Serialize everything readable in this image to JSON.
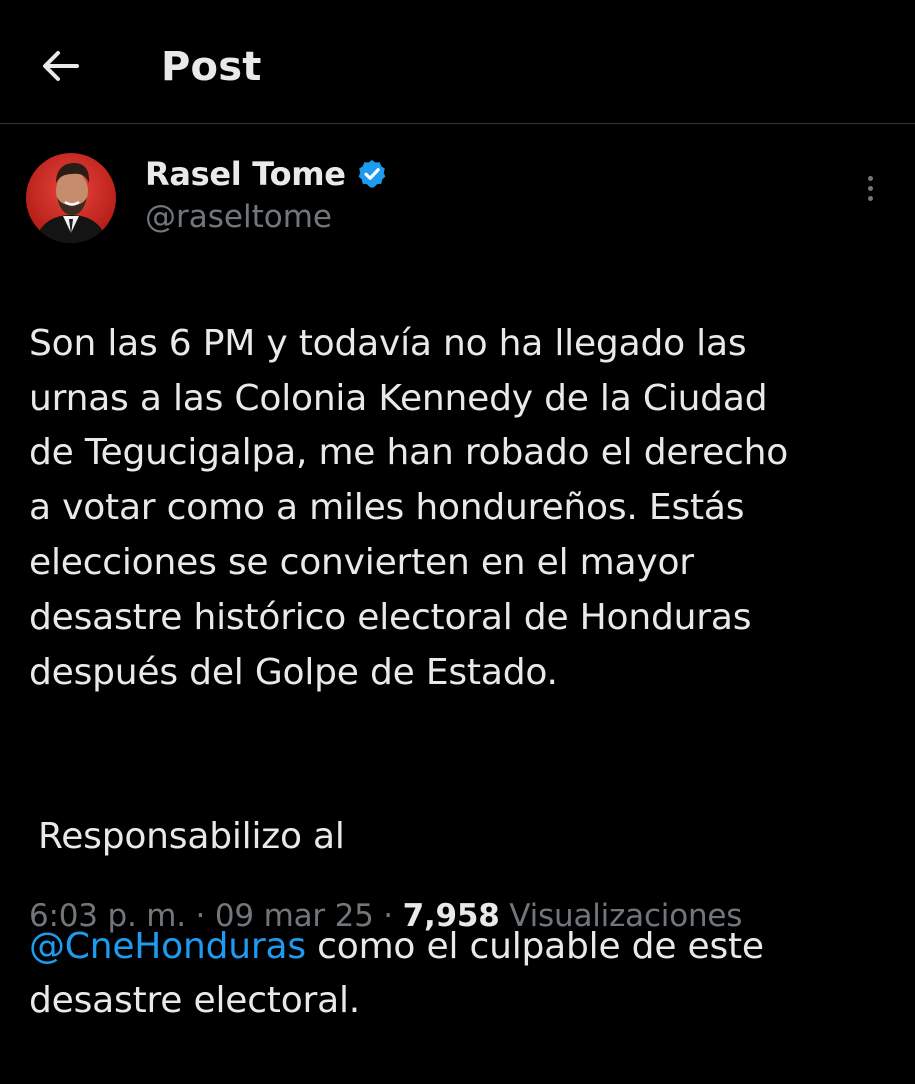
{
  "header": {
    "title": "Post",
    "back_icon": "arrow-left-icon"
  },
  "author": {
    "display_name": "Rasel Tome",
    "handle": "@raseltome",
    "verified_icon": "verified-badge-icon",
    "verified_color": "#1d9bf0"
  },
  "more_icon": "more-vertical-icon",
  "post": {
    "paragraph1_lines": [
      "Son las 6 PM y todavía no ha llegado las",
      "urnas a las Colonia Kennedy de la Ciudad",
      "de Tegucigalpa, me han robado el derecho",
      "a votar como a miles hondureños. Estás",
      "elecciones se convierten en el mayor",
      "desastre histórico electoral de Honduras",
      "después del Golpe de Estado."
    ],
    "paragraph2_line1": "Responsabilizo al",
    "mention": "@CneHonduras",
    "paragraph2_line2_rest": " como el culpable de este",
    "paragraph2_line3": "desastre electoral."
  },
  "meta": {
    "time": "6:03 p. m.",
    "separator": " · ",
    "date": "09 mar 25",
    "views_count": "7,958",
    "views_label": " Visualizaciones"
  },
  "colors": {
    "background": "#000000",
    "text": "#e7e9ea",
    "secondary": "#71767b",
    "accent": "#1d9bf0",
    "divider": "#2f3336"
  }
}
